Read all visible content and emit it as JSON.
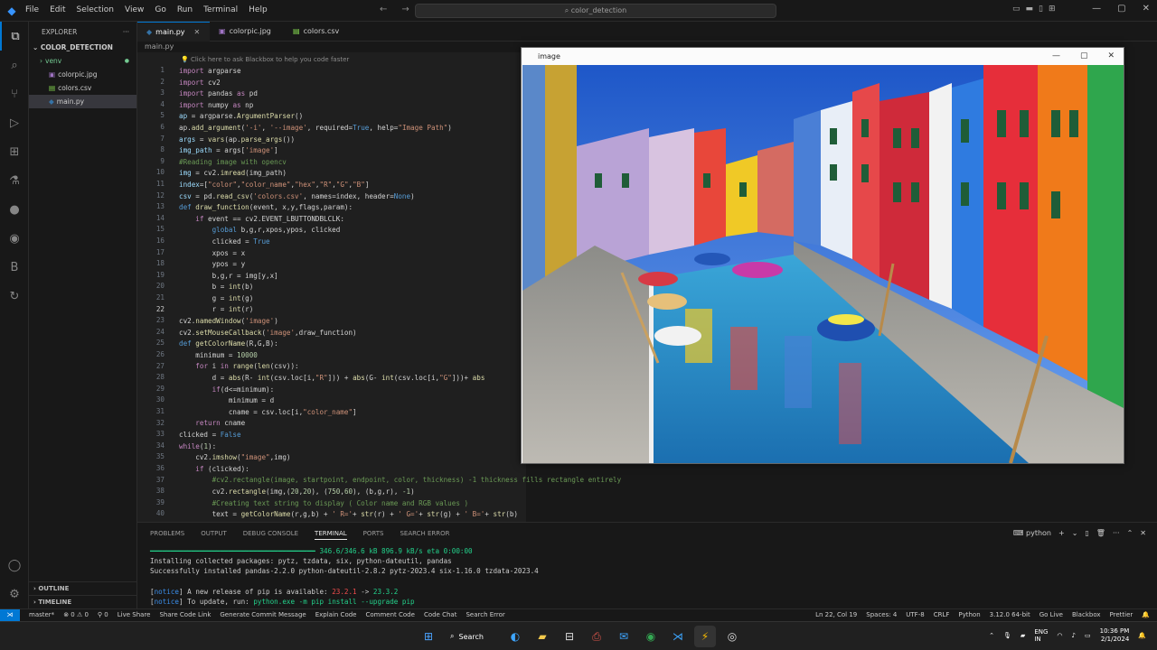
{
  "menu": [
    "File",
    "Edit",
    "Selection",
    "View",
    "Go",
    "Run",
    "Terminal",
    "Help"
  ],
  "command_center": "color_detection",
  "sidebar": {
    "header": "EXPLORER",
    "folder": "COLOR_DETECTION",
    "items": [
      {
        "label": "venv",
        "icon": "folder-icon"
      },
      {
        "label": "colorpic.jpg",
        "icon": "image-file-icon"
      },
      {
        "label": "colors.csv",
        "icon": "csv-file-icon"
      },
      {
        "label": "main.py",
        "icon": "python-file-icon"
      }
    ],
    "outline": "OUTLINE",
    "timeline": "TIMELINE"
  },
  "tabs": [
    {
      "label": "main.py",
      "active": true
    },
    {
      "label": "colorpic.jpg",
      "active": false
    },
    {
      "label": "colors.csv",
      "active": false
    }
  ],
  "breadcrumb": "main.py",
  "editor": {
    "hint": "Click here to ask Blackbox to help you code faster",
    "line_numbers": [
      "1",
      "2",
      "3",
      "4",
      "5",
      "6",
      "7",
      "8",
      "9",
      "10",
      "11",
      "12",
      "13",
      "14",
      "15",
      "16",
      "17",
      "18",
      "19",
      "20",
      "21",
      "22",
      "23",
      "24",
      "25",
      "26",
      "27",
      "28",
      "29",
      "30",
      "31",
      "32",
      "33",
      "34",
      "35",
      "36",
      "37",
      "38",
      "39",
      "40"
    ]
  },
  "image_window": {
    "title": "image"
  },
  "panel": {
    "tabs": [
      "PROBLEMS",
      "OUTPUT",
      "DEBUG CONSOLE",
      "TERMINAL",
      "PORTS",
      "SEARCH ERROR"
    ],
    "active_tab": "TERMINAL",
    "shell": "python",
    "terminal": {
      "progress": "346.6/346.6 kB 896.9 kB/s eta 0:00:00",
      "line1": "Installing collected packages: pytz, tzdata, six, python-dateutil, pandas",
      "line2": "Successfully installed pandas-2.2.0 python-dateutil-2.8.2 pytz-2023.4 six-1.16.0 tzdata-2023.4",
      "notice1_pre": "A new release of pip is available: ",
      "notice1_old": "23.2.1",
      "notice1_new": "23.3.2",
      "notice2_pre": "To update, run: ",
      "notice2_cmd": "python.exe -m pip install --upgrade pip",
      "notice_tag": "notice"
    }
  },
  "statusbar": {
    "left": [
      "master*",
      "⊗ 0 ⚠ 0",
      "⚲ 0",
      "Live Share",
      "Share Code Link",
      "Generate Commit Message",
      "Explain Code",
      "Comment Code",
      "Code Chat",
      "Search Error"
    ],
    "right": [
      "Ln 22, Col 19",
      "Spaces: 4",
      "UTF-8",
      "CRLF",
      "Python",
      "3.12.0 64-bit",
      "Go Live",
      "Blackbox",
      "Prettier"
    ]
  },
  "taskbar": {
    "search": "Search",
    "lang1": "ENG",
    "lang2": "IN",
    "time": "10:36 PM",
    "date": "2/1/2024"
  }
}
